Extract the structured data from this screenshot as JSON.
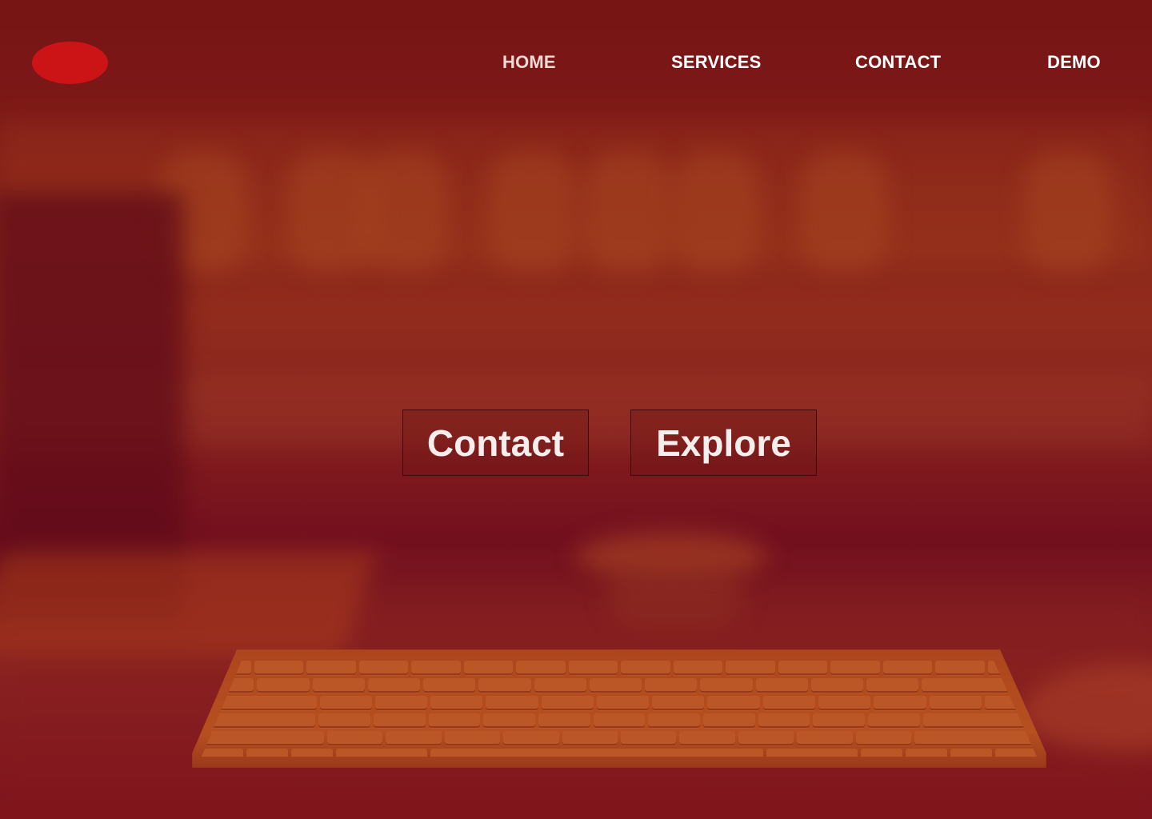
{
  "header": {
    "logo_icon": "logo-oval",
    "logo_color": "#cc1416",
    "nav": [
      {
        "label": "HOME"
      },
      {
        "label": "SERVICES"
      },
      {
        "label": "CONTACT"
      },
      {
        "label": "DEMO"
      }
    ]
  },
  "hero": {
    "primary_label": "Contact",
    "secondary_label": "Explore"
  },
  "theme": {
    "overlay_color": "#8a1a1a",
    "accent": "#cc1416"
  }
}
